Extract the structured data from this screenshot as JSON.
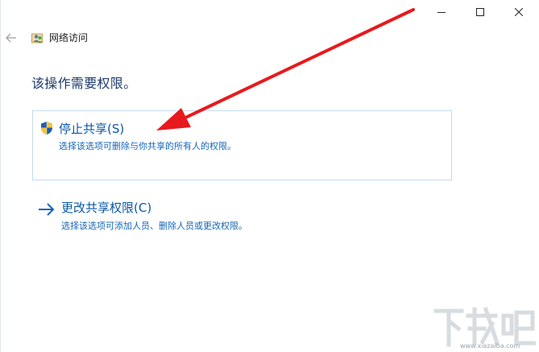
{
  "window": {
    "title": "网络访问",
    "caption": {
      "minimize_icon": "minimize-icon",
      "maximize_icon": "maximize-icon",
      "close_icon": "close-icon"
    }
  },
  "header": {
    "back_icon": "back-arrow-icon",
    "app_icon": "network-users-icon"
  },
  "main": {
    "heading": "该操作需要权限。",
    "options": [
      {
        "title": "停止共享(S)",
        "description": "选择该选项可删除与你共享的所有人的权限。",
        "icon": "uac-shield-icon"
      },
      {
        "title": "更改共享权限(C)",
        "description": "选择该选项可添加人员、删除人员或更改权限。",
        "icon": "right-arrow-icon"
      }
    ]
  },
  "colors": {
    "accent": "#0b57a6",
    "annotation": "#e8191c"
  },
  "watermark": {
    "text": "下载吧",
    "site": "www.xiazaiba.com"
  }
}
